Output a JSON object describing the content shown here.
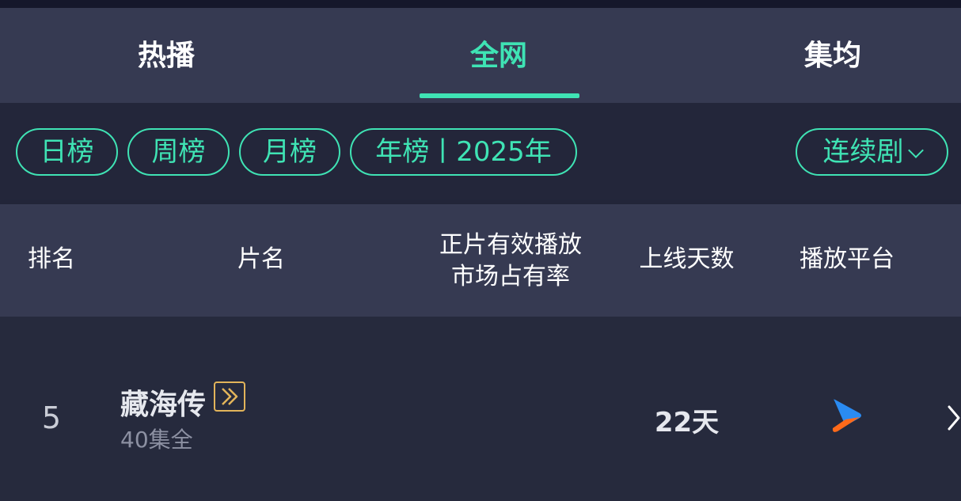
{
  "tabs": [
    {
      "label": "热播",
      "active": false
    },
    {
      "label": "全网",
      "active": true
    },
    {
      "label": "集均",
      "active": false
    }
  ],
  "filters": {
    "daily": "日榜",
    "weekly": "周榜",
    "monthly": "月榜",
    "yearly": "年榜丨2025年",
    "category": "连续剧"
  },
  "columns": {
    "rank": "排名",
    "title": "片名",
    "share_line1": "正片有效播放",
    "share_line2": "市场占有率",
    "days": "上线天数",
    "platform": "播放平台"
  },
  "rows": [
    {
      "rank": "5",
      "title": "藏海传",
      "episodes": "40集全",
      "share": "",
      "days": "22天",
      "platform_icon": "youku-play-icon"
    }
  ],
  "colors": {
    "accent": "#3fe3b4",
    "badge": "#e2b45a",
    "platform_blue": "#2a8bf2",
    "platform_orange": "#ff6a1a"
  }
}
